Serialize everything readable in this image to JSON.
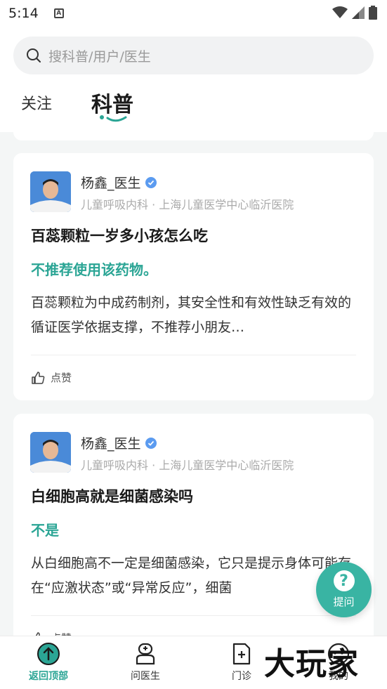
{
  "status": {
    "time": "5:14"
  },
  "search": {
    "placeholder": "搜科普/用户/医生"
  },
  "tabs": [
    {
      "label": "关注"
    },
    {
      "label": "科普"
    }
  ],
  "cards": [
    {
      "doctor": "杨鑫_医生",
      "dept": "儿童呼吸内科 · 上海儿童医学中心临沂医院",
      "title": "百蕊颗粒一岁多小孩怎么吃",
      "answer": "不推荐使用该药物。",
      "body": "百蕊颗粒为中成药制剂，其安全性和有效性缺乏有效的循证医学依据支撑，不推荐小朋友…",
      "like_label": "点赞"
    },
    {
      "doctor": "杨鑫_医生",
      "dept": "儿童呼吸内科 · 上海儿童医学中心临沂医院",
      "title": "白细胞高就是细菌感染吗",
      "answer": "不是",
      "body": "从白细胞高不一定是细菌感染，它只是提示身体可能存在“应激状态”或“异常反应”，细菌",
      "like_label": "点赞"
    }
  ],
  "fab": {
    "label": "提问",
    "icon": "question-icon"
  },
  "nav": [
    {
      "label": "返回顶部",
      "icon": "arrow-up-circle-icon"
    },
    {
      "label": "问医生",
      "icon": "doctor-icon"
    },
    {
      "label": "门诊",
      "icon": "clinic-icon"
    },
    {
      "label": "我的",
      "icon": "profile-icon"
    }
  ],
  "watermark": "大玩家",
  "colors": {
    "accent": "#2ba595",
    "fab": "#39b4a3"
  }
}
